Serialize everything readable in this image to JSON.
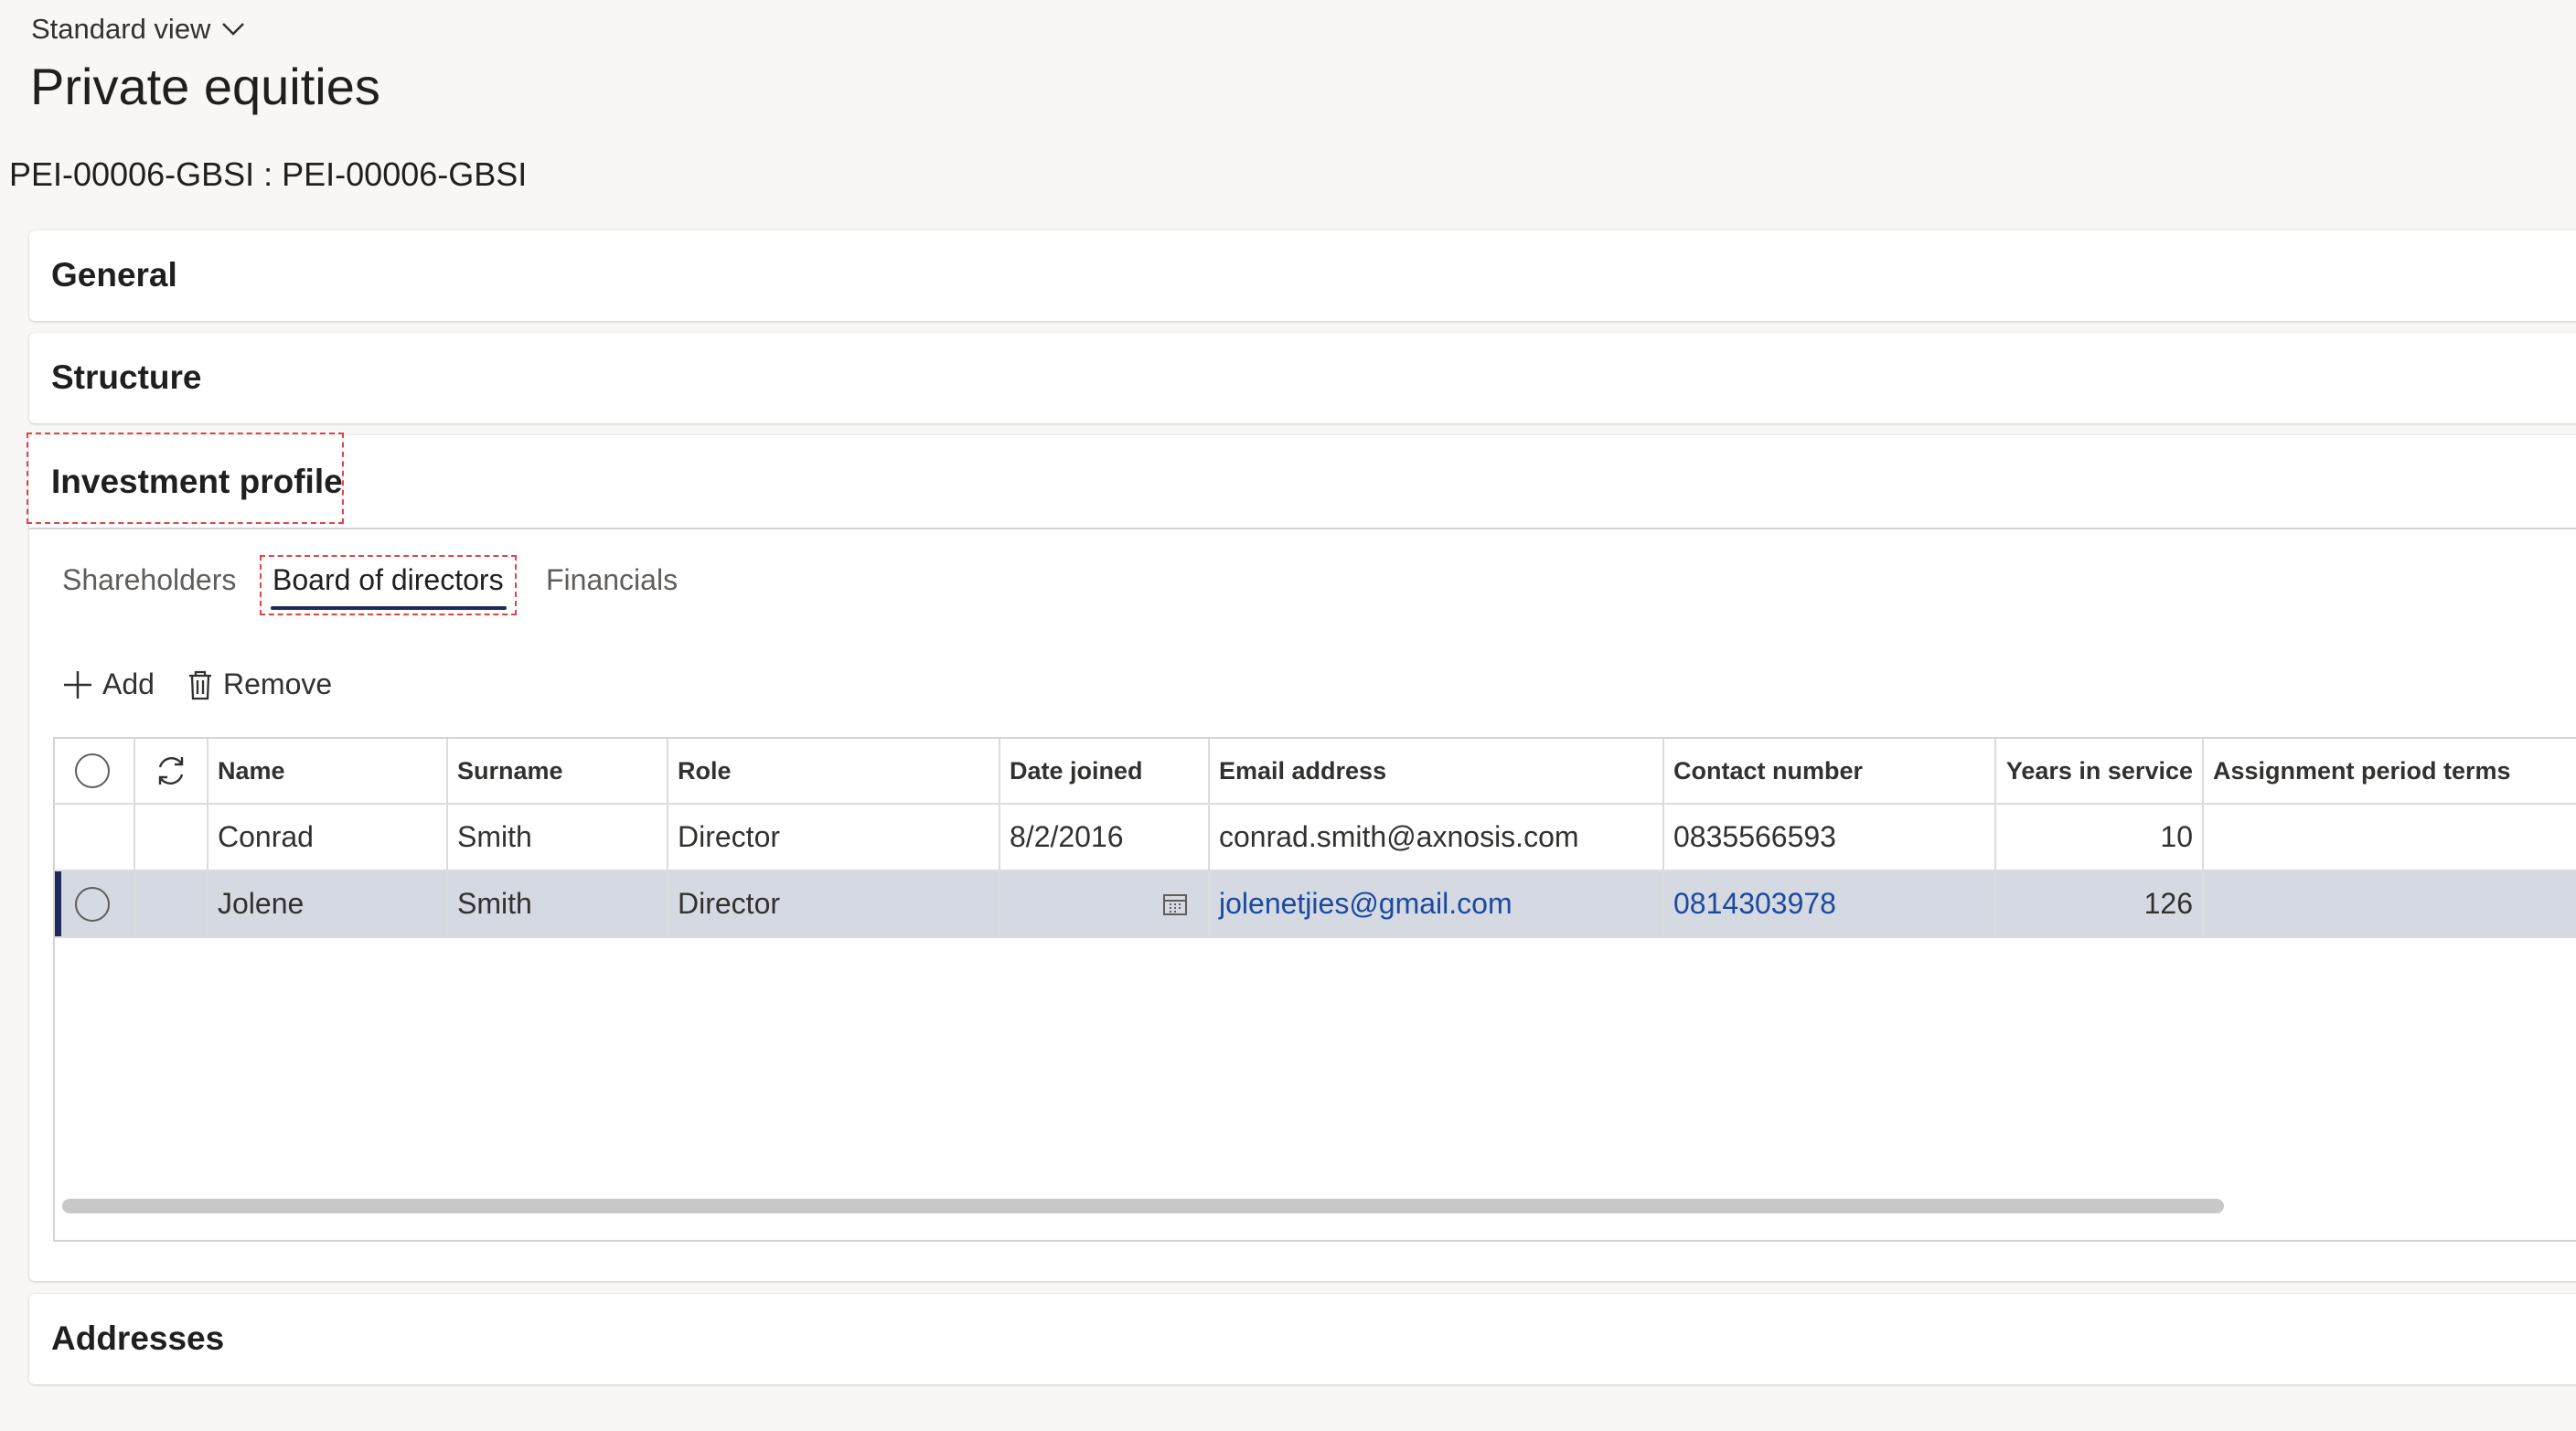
{
  "header": {
    "view_label": "Standard view",
    "title": "Private equities",
    "record_id": "PEI-00006-GBSI : PEI-00006-GBSI"
  },
  "fasttabs": {
    "general": "General",
    "structure": "Structure",
    "investment_profile": "Investment profile",
    "addresses": "Addresses"
  },
  "subtabs": {
    "shareholders": "Shareholders",
    "board_of_directors": "Board of directors",
    "financials": "Financials",
    "active": "Board of directors"
  },
  "toolbar": {
    "add_label": "Add",
    "remove_label": "Remove"
  },
  "grid": {
    "columns": {
      "name": "Name",
      "surname": "Surname",
      "role": "Role",
      "date_joined": "Date joined",
      "email": "Email address",
      "contact": "Contact number",
      "years": "Years in service",
      "terms": "Assignment period terms"
    },
    "rows": [
      {
        "name": "Conrad",
        "surname": "Smith",
        "role": "Director",
        "date_joined": "8/2/2016",
        "email": "conrad.smith@axnosis.com",
        "contact": "0835566593",
        "years": "10",
        "terms": ""
      },
      {
        "name": "Jolene",
        "surname": "Smith",
        "role": "Director",
        "date_joined": "",
        "email": "jolenetjies@gmail.com",
        "contact": "0814303978",
        "years": "126",
        "terms": ""
      }
    ],
    "selected_row_index": 1
  },
  "colors": {
    "accent": "#1f2a5c",
    "link": "#1b4aa0",
    "highlight_box": "#e0444a",
    "selected_row": "#d5d9e1"
  },
  "icons": {
    "view_dropdown": "chevron-down-icon",
    "add": "plus-icon",
    "remove": "trash-icon",
    "refresh": "refresh-icon",
    "date_picker": "calendar-icon"
  }
}
